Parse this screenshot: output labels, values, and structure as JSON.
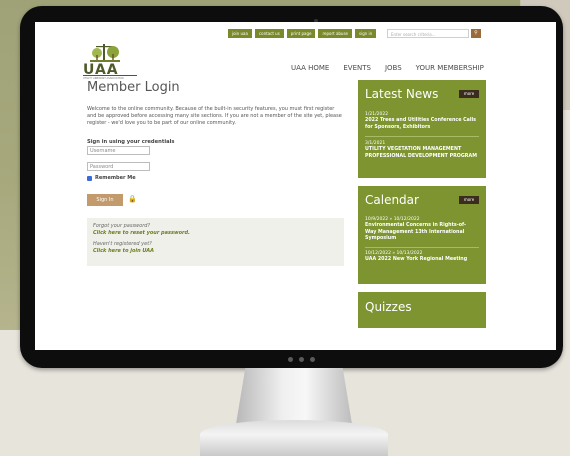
{
  "site": {
    "logo_text": "UAA",
    "logo_subtitle": "UTILITY ARBORIST ASSOCIATION"
  },
  "topbar": {
    "buttons": [
      "join uaa",
      "contact us",
      "print page",
      "report abuse",
      "sign in"
    ],
    "search_placeholder": "Enter search criteria...",
    "search_button_icon": "search-icon"
  },
  "nav": [
    "UAA HOME",
    "EVENTS",
    "JOBS",
    "YOUR MEMBERSHIP"
  ],
  "login": {
    "title": "Member Login",
    "intro": "Welcome to the online community. Because of the built-in security features, you must first register and be approved before accessing many site sections. If you are not a member of the site yet, please register - we'd love you to be part of our online community.",
    "credentials_heading": "Sign in using your credentials",
    "username_placeholder": "Username",
    "password_placeholder": "Password",
    "remember_label": "Remember Me",
    "remember_checked": true,
    "signin_label": "Sign In",
    "forgot_label": "Forgot your password?",
    "reset_link": "Click here to reset your password.",
    "not_registered": "Haven't registered yet?",
    "join_link": "Click here to join UAA"
  },
  "news": {
    "title": "Latest News",
    "more_label": "more",
    "items": [
      {
        "date": "1/21/2022",
        "title": "2022 Trees and Utilities Conference Calls for Sponsors, Exhibitors"
      },
      {
        "date": "3/1/2021",
        "title": "UTILITY VEGETATION MANAGEMENT PROFESSIONAL DEVELOPMENT PROGRAM"
      }
    ]
  },
  "calendar": {
    "title": "Calendar",
    "more_label": "more",
    "items": [
      {
        "date": "10/9/2022 » 10/12/2022",
        "title": "Environmental Concerns in Rights-of-Way Management 13th International Symposium"
      },
      {
        "date": "10/12/2022 » 10/13/2022",
        "title": "UAA 2022 New York Regional Meeting"
      }
    ]
  },
  "quizzes": {
    "title": "Quizzes"
  },
  "colors": {
    "accent_green": "#7d9430",
    "signin_tan": "#c29a6c",
    "more_brown": "#3a2d1e"
  }
}
